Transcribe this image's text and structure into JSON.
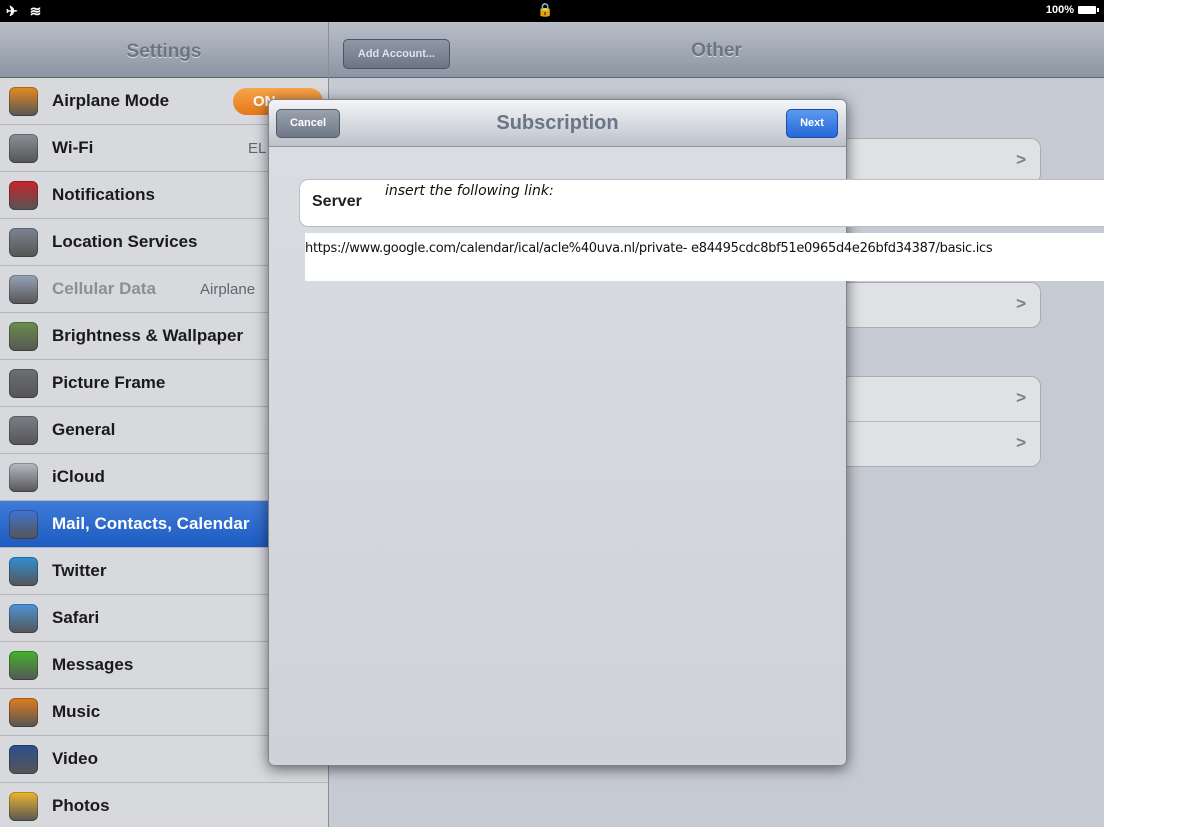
{
  "status_bar": {
    "left_icons": "✈ ≋",
    "lock": "🔒",
    "battery_text": "100%"
  },
  "sidebar": {
    "title": "Settings",
    "items": [
      {
        "label": "Airplane Mode",
        "icon": "airplane-icon",
        "color": "#e78b1f",
        "toggle": "ON"
      },
      {
        "label": "Wi-Fi",
        "icon": "wifi-icon",
        "color": "#8a9099",
        "value": "EL"
      },
      {
        "label": "Notifications",
        "icon": "notifications-icon",
        "color": "#c8242b"
      },
      {
        "label": "Location Services",
        "icon": "location-icon",
        "color": "#7b8590"
      },
      {
        "label": "Cellular Data",
        "icon": "cellular-icon",
        "color": "#98a3b8",
        "value": "Airplane"
      },
      {
        "label": "Brightness & Wallpaper",
        "icon": "brightness-icon",
        "color": "#6b8e4e"
      },
      {
        "label": "Picture Frame",
        "icon": "picture-frame-icon",
        "color": "#6c6f74"
      },
      {
        "label": "General",
        "icon": "gear-icon",
        "color": "#7a7f86"
      },
      {
        "label": "iCloud",
        "icon": "icloud-icon",
        "color": "#b6bcc5"
      },
      {
        "label": "Mail, Contacts, Calendar",
        "icon": "mail-icon",
        "color": "#3e74d1",
        "selected": true
      },
      {
        "label": "Twitter",
        "icon": "twitter-icon",
        "color": "#2f8fd6"
      },
      {
        "label": "Safari",
        "icon": "safari-icon",
        "color": "#4c94d8"
      },
      {
        "label": "Messages",
        "icon": "messages-icon",
        "color": "#43b32e"
      },
      {
        "label": "Music",
        "icon": "music-icon",
        "color": "#e07b1e"
      },
      {
        "label": "Video",
        "icon": "video-icon",
        "color": "#2c4f8c"
      },
      {
        "label": "Photos",
        "icon": "photos-icon",
        "color": "#f0b62f"
      }
    ]
  },
  "detail": {
    "title": "Other",
    "back_button": "Add Account..."
  },
  "modal": {
    "title": "Subscription",
    "cancel_label": "Cancel",
    "next_label": "Next",
    "server_label": "Server",
    "server_note": "insert the following link:",
    "link": "https://www.google.com/calendar/ical/acle%40uva.nl/private- e84495cdc8bf51e0965d4e26bfd34387/basic.ics"
  }
}
